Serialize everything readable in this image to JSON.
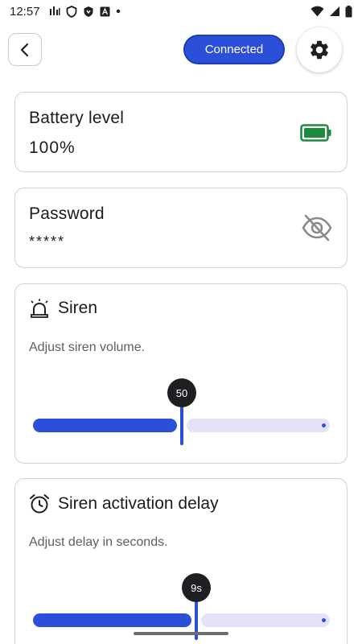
{
  "status_bar": {
    "time": "12:57",
    "left_icons": [
      "signal-bars-icon",
      "shield-icon",
      "shield-filled-icon",
      "a-badge-icon",
      "dot-icon"
    ],
    "right_icons": [
      "wifi-icon",
      "cell-signal-icon",
      "battery-icon"
    ]
  },
  "header": {
    "back_icon": "chevron-left-icon",
    "connection_label": "Connected",
    "settings_icon": "gear-icon",
    "accent_color": "#2b4fd8"
  },
  "battery": {
    "title": "Battery level",
    "value": "100%",
    "icon": "battery-full-icon",
    "icon_color": "#1e8a3e"
  },
  "password": {
    "title": "Password",
    "value": "*****",
    "icon": "eye-off-icon"
  },
  "siren": {
    "title": "Siren",
    "icon": "siren-icon",
    "description": "Adjust siren volume.",
    "slider": {
      "value_label": "50",
      "value": 50,
      "min": 0,
      "max": 100
    }
  },
  "delay": {
    "title": "Siren activation delay",
    "icon": "alarm-clock-icon",
    "description": "Adjust delay in seconds.",
    "slider": {
      "value_label": "9s",
      "value": 0.55
    }
  }
}
